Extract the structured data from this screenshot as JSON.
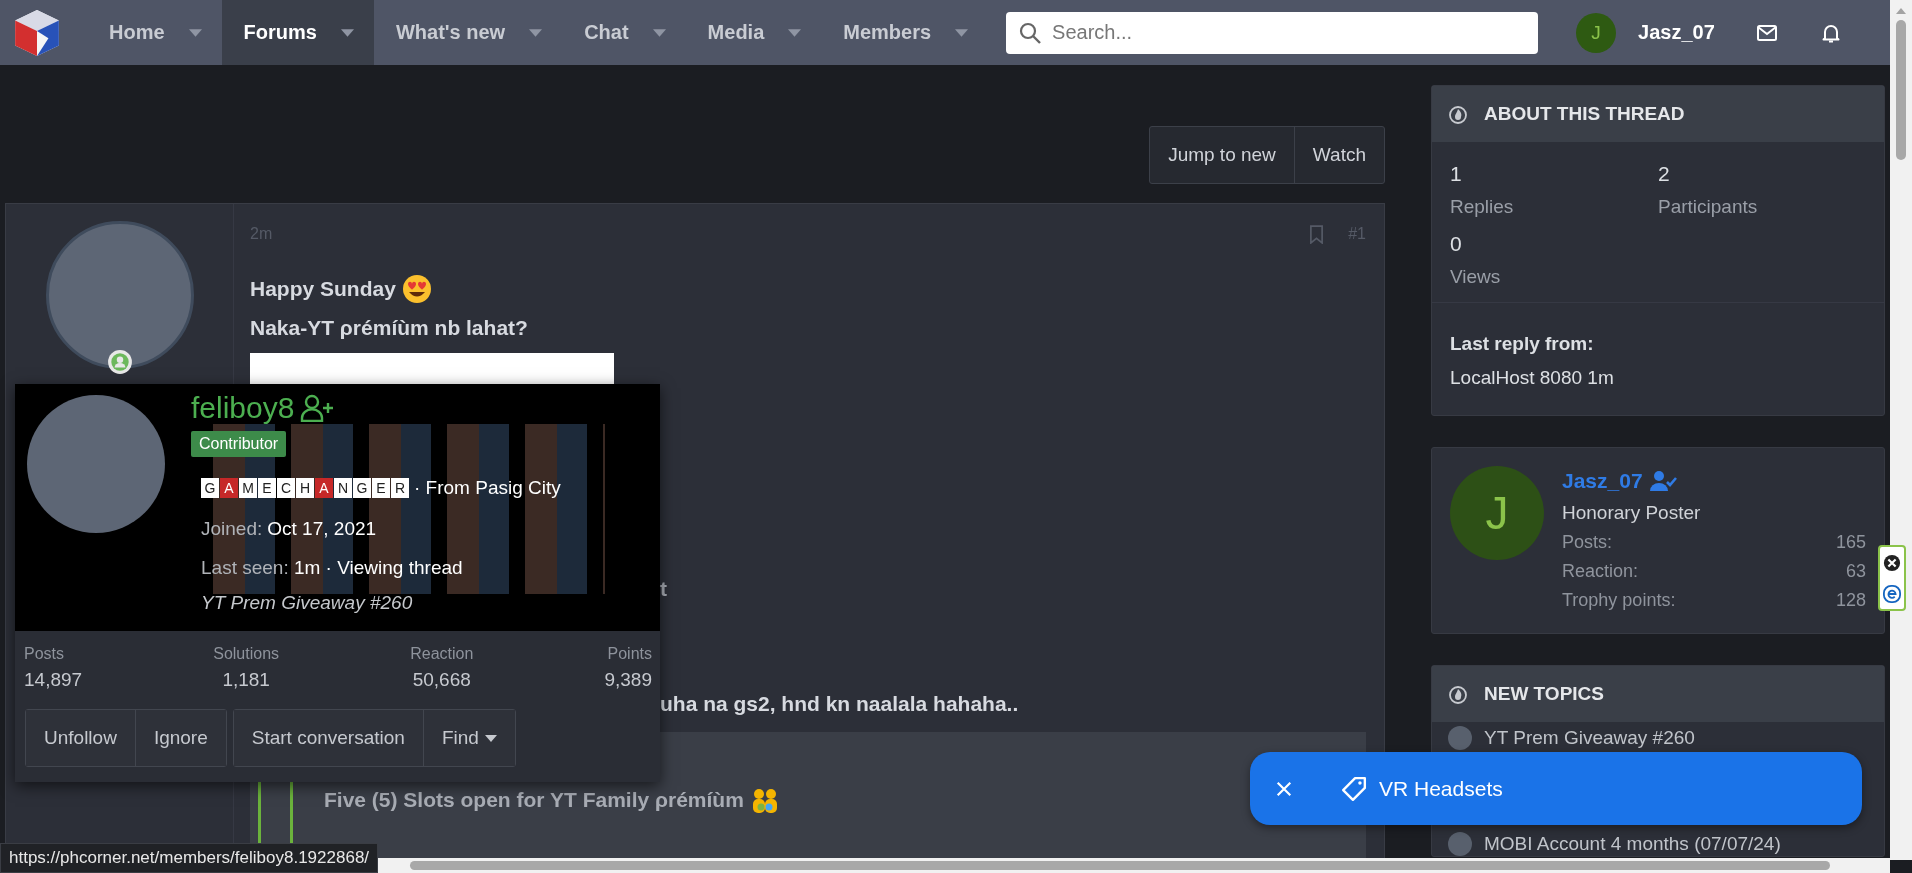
{
  "nav": {
    "items": [
      {
        "label": "Home",
        "selected": false
      },
      {
        "label": "Forums",
        "selected": true
      },
      {
        "label": "What's new",
        "selected": false
      },
      {
        "label": "Chat",
        "selected": false
      },
      {
        "label": "Media",
        "selected": false
      },
      {
        "label": "Members",
        "selected": false
      }
    ],
    "search": {
      "placeholder": "Search..."
    },
    "user": {
      "initial": "J",
      "name": "Jasz_07"
    }
  },
  "thread_actions": [
    "Jump to new",
    "Watch"
  ],
  "post": {
    "time": "2m",
    "number": "#1",
    "greeting": "Happy Sunday",
    "question": "Naka-YT ρrémíùm nb lahat?",
    "fragments": [
      "t",
      "uha na gs2, hnd kn naalala hahaha.."
    ],
    "quote_title": "Five (5) Slots open for YT Family ρrémíùm"
  },
  "member_card": {
    "username": "feliboy8",
    "badge": "Contributor",
    "title_tiles": [
      {
        "letter": "G",
        "color": "#ffffff"
      },
      {
        "letter": "A",
        "color": "#c62828"
      },
      {
        "letter": "M",
        "color": "#ffffff"
      },
      {
        "letter": "E",
        "color": "#ffffff"
      },
      {
        "letter": "C",
        "color": "#ffffff"
      },
      {
        "letter": "H",
        "color": "#ffffff"
      },
      {
        "letter": "A",
        "color": "#c62828"
      },
      {
        "letter": "N",
        "color": "#ffffff"
      },
      {
        "letter": "G",
        "color": "#ffffff"
      },
      {
        "letter": "E",
        "color": "#ffffff"
      },
      {
        "letter": "R",
        "color": "#ffffff"
      }
    ],
    "location": "· From Pasig City",
    "joined_label": "Joined:",
    "joined": "Oct 17, 2021",
    "last_seen_label": "Last seen:",
    "last_seen": "1m · Viewing thread",
    "thread": "YT Prem Giveaway #260",
    "stats": [
      {
        "label": "Posts",
        "value": "14,897"
      },
      {
        "label": "Solutions",
        "value": "1,181"
      },
      {
        "label": "Reaction",
        "value": "50,668"
      },
      {
        "label": "Points",
        "value": "9,389"
      }
    ],
    "button_groups": [
      [
        {
          "label": "Unfollow",
          "kind": "plain"
        },
        {
          "label": "Ignore",
          "kind": "plain"
        }
      ],
      [
        {
          "label": "Start conversation",
          "kind": "plain"
        },
        {
          "label": "Find",
          "kind": "dropdown"
        }
      ]
    ]
  },
  "about": {
    "title": "ABOUT THIS THREAD",
    "stats": [
      {
        "value": "1",
        "label": "Replies"
      },
      {
        "value": "2",
        "label": "Participants"
      },
      {
        "value": "0",
        "label": "Views"
      }
    ],
    "last_reply_label": "Last reply from:",
    "last_reply": "LocalHost 8080 1m"
  },
  "visitor": {
    "initial": "J",
    "name": "Jasz_07",
    "title": "Honorary Poster",
    "stats": [
      {
        "label": "Posts:",
        "value": "165"
      },
      {
        "label": "Reaction:",
        "value": "63"
      },
      {
        "label": "Trophy points:",
        "value": "128"
      }
    ]
  },
  "new_topics": {
    "title": "NEW TOPICS",
    "items": [
      "YT Prem Giveaway #260",
      "MOBI Account 4 months (07/07/24)"
    ]
  },
  "toast": {
    "label": "VR Headsets"
  },
  "status_url": "https://phcorner.net/members/feliboy8.1922868/"
}
